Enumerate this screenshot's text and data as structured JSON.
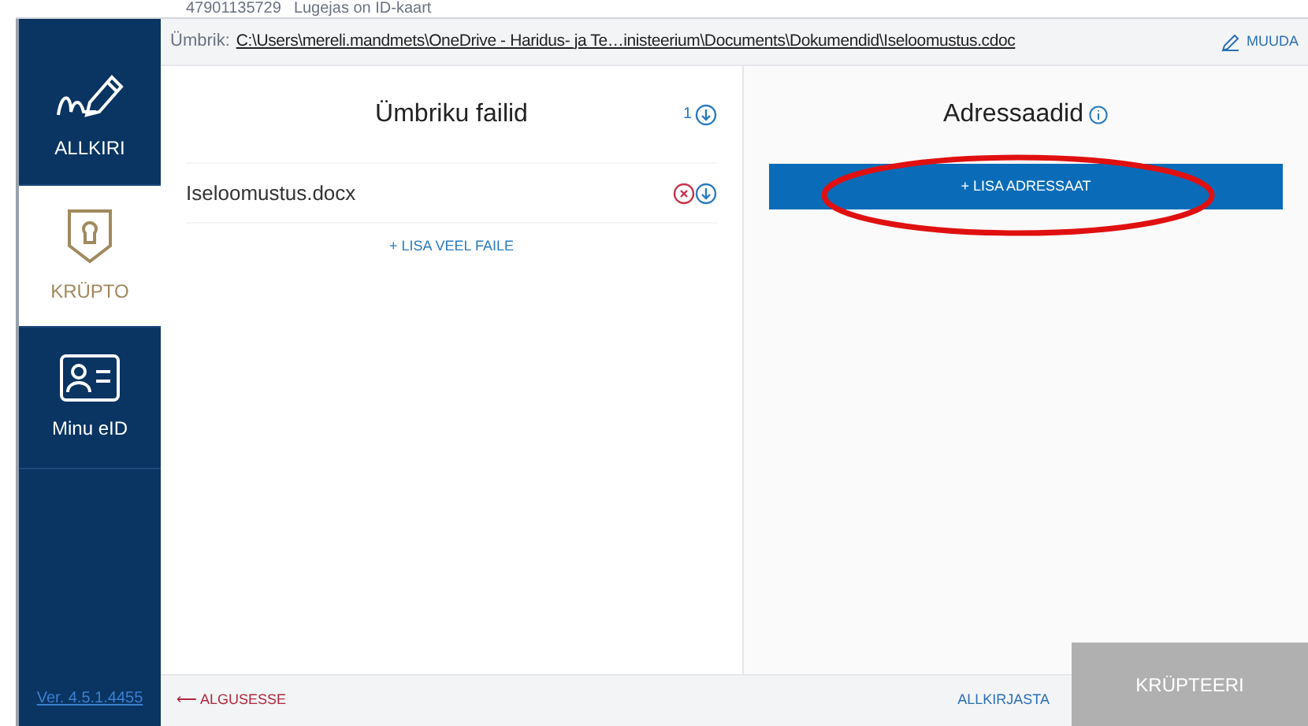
{
  "top_info": {
    "id_code": "47901135729",
    "reader_status": "Lugejas on ID-kaart"
  },
  "envelope_bar": {
    "label": "Ümbrik:",
    "path": "C:\\Users\\mereli.mandmets\\OneDrive - Haridus- ja Te…inisteerium\\Documents\\Dokumendid\\Iseloomustus.cdoc",
    "edit": "MUUDA"
  },
  "sidebar": {
    "items": [
      {
        "label": "ALLKIRI",
        "kind": "signature",
        "selected": false
      },
      {
        "label": "KRÜPTO",
        "kind": "crypto",
        "selected": true
      },
      {
        "label": "Minu eID",
        "kind": "eid",
        "selected": false
      }
    ],
    "version": "Ver. 4.5.1.4455"
  },
  "files_panel": {
    "title": "Ümbriku failid",
    "count": "1",
    "files": [
      "Iseloomustus.docx"
    ],
    "add_more": "+ LISA VEEL FAILE"
  },
  "recipients_panel": {
    "title": "Adressaadid",
    "add_button": "+ LISA ADRESSAAT"
  },
  "footer": {
    "back": "⟵ ALGUSESSE",
    "sign": "ALLKIRJASTA",
    "encrypt": {
      "label": "KRÜPTEERI",
      "disabled": true
    }
  }
}
